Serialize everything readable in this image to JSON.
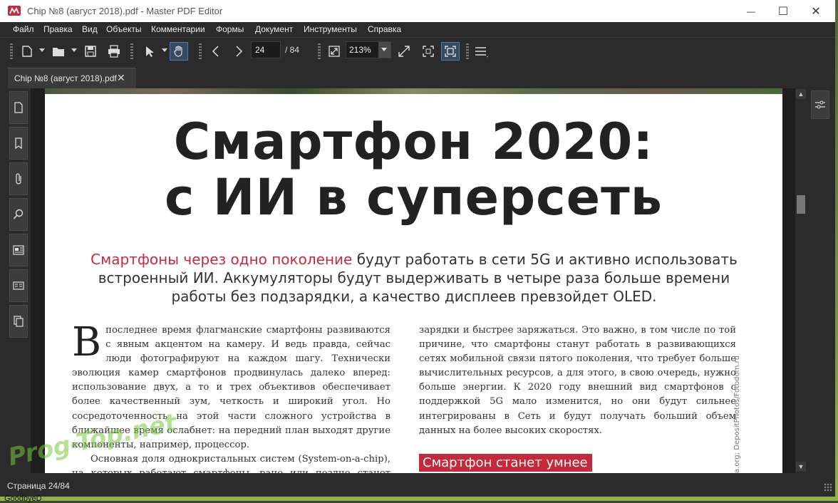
{
  "window": {
    "title": "Chip №8 (август 2018).pdf - Master PDF Editor",
    "controls": {
      "minimize": "—",
      "maximize": "☐",
      "close": "✕"
    }
  },
  "menu": [
    "Файл",
    "Правка",
    "Вид",
    "Объекты",
    "Комментарии",
    "Формы",
    "Документ",
    "Инструменты",
    "Справка"
  ],
  "toolbar": {
    "current_page": "24",
    "total_pages": "/ 84",
    "zoom": "213%",
    "icons": [
      "new-document-icon",
      "open-folder-icon",
      "save-icon",
      "print-icon",
      "select-arrow-icon",
      "hand-tool-icon",
      "previous-page-icon",
      "next-page-icon",
      "fit-page-icon",
      "fit-width-icon",
      "actual-size-icon",
      "fullscreen-icon",
      "menu-icon"
    ]
  },
  "tab": {
    "label": "Chip №8 (август 2018).pdf",
    "close": "✕"
  },
  "left_panel_icons": [
    "pages-icon",
    "bookmarks-icon",
    "attachments-icon",
    "search-icon",
    "layers-icon",
    "signatures-icon",
    "copy-icon"
  ],
  "right_panel_icons": [
    "properties-slider-icon"
  ],
  "document": {
    "headline_line1": "Смартфон 2020:",
    "headline_line2": "с ИИ в суперсеть",
    "lead_highlight": "Смартфоны через одно поколение",
    "lead_rest": " будут работать в сети 5G и активно использовать встроенный ИИ. Аккумуляторы будут выдерживать в четыре раза больше времени работы без подзарядки, а качество дисплеев превзойдет OLED.",
    "col1_dropcap": "В",
    "col1_p1": "последнее время флагманские смартфоны развиваются с явным акцентом на камеру. И ведь правда, сейчас люди фотографируют на каждом шагу. Технически эволюция камер смартфонов продвинулась далеко вперед: использование двух, а то и трех объективов обеспечивает более качественный зум, четкость и широкий угол. Но сосредоточенность на этой части сложного устройства в ближайшее время ослабнет: на передний план выходят другие компоненты, например, процессор.",
    "col1_p2": "Основная доля однокристальных систем (System-on-a-chip), на которых работают смартфоны, рано или поздно станет обеспечивать качественный интеллект, направленный",
    "col2_p1": "зарядки и быстрее заряжаться. Это важно, в том числе по той причине, что смартфоны станут работать в развивающихся сетях мобильной связи пятого поколения, что требует больше вычислительных ресурсов, а для этого, в свою очередь, нужно больше энергии. К 2020 году внешний вид смартфонов с поддержкой 5G мало изменится, но они будут сильнее интегрированы в Сеть и будут получать больший объем данных на более высоких скоростях.",
    "subhead": "Смартфон станет умнее",
    "photo_credit": "a.org; DepositPhotos/Fotodom.ru"
  },
  "status": {
    "page_label": "Страница 24/84"
  },
  "watermark": "Prog-Top.net",
  "taskbar_peek": "GoodbyeD",
  "colors": {
    "accent_red": "#c62a3a",
    "chrome": "#2b2b2b",
    "active_tool": "#4a7ab8"
  }
}
